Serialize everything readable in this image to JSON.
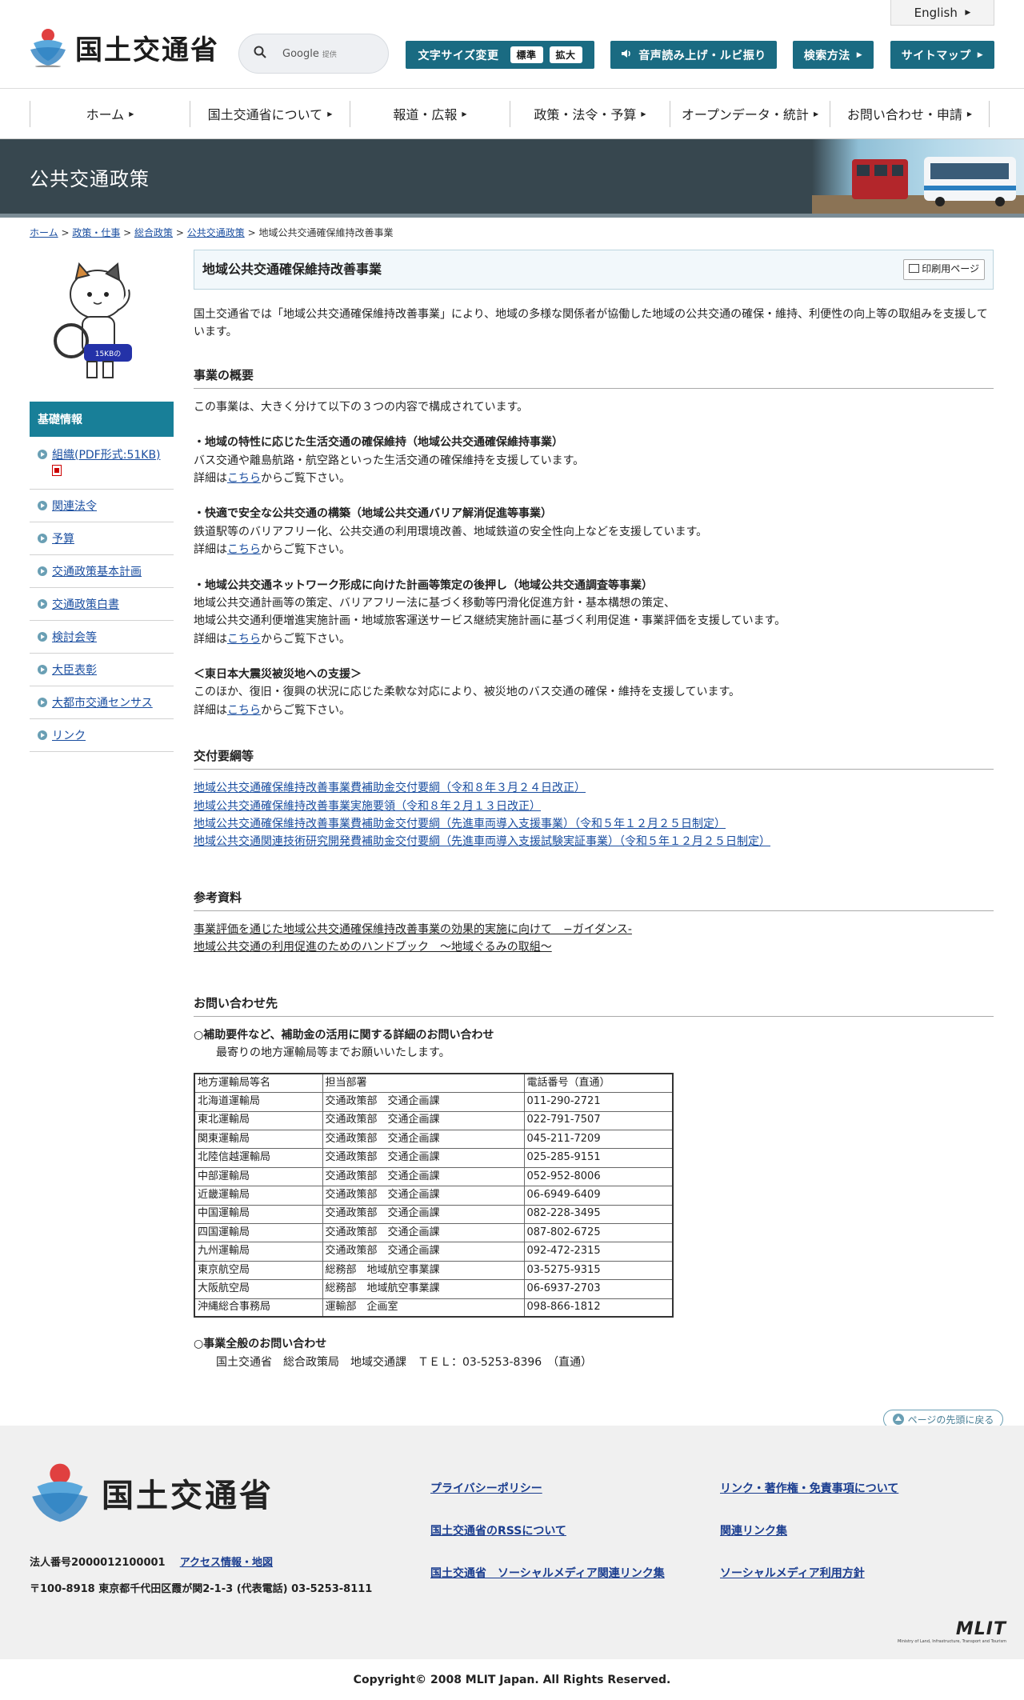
{
  "header": {
    "logo_text": "国土交通省",
    "search_label": "Google",
    "search_sub": "提供",
    "lang_label": "English",
    "font_size_label": "文字サイズ変更",
    "font_normal": "標準",
    "font_large": "拡大",
    "speech_label": "音声読み上げ・ルビ振り",
    "search_method": "検索方法",
    "sitemap": "サイトマップ"
  },
  "nav": [
    "ホーム",
    "国土交通省について",
    "報道・広報",
    "政策・法令・予算",
    "オープンデータ・統計",
    "お問い合わせ・申請"
  ],
  "banner": {
    "title": "公共交通政策"
  },
  "breadcrumb": [
    {
      "label": "ホーム",
      "link": true
    },
    {
      "label": "政策・仕事",
      "link": true
    },
    {
      "label": "総合政策",
      "link": true
    },
    {
      "label": "公共交通政策",
      "link": true
    },
    {
      "label": "地域公共交通確保維持改善事業",
      "link": false
    }
  ],
  "sidebar": {
    "mascot_text": "15KBの",
    "heading": "基礎情報",
    "items": [
      "組織(PDF形式:51KB)",
      "関連法令",
      "予算",
      "交通政策基本計画",
      "交通政策白書",
      "検討会等",
      "大臣表彰",
      "大都市交通センサス",
      "リンク"
    ]
  },
  "main": {
    "title": "地域公共交通確保維持改善事業",
    "print_label": "印刷用ページ",
    "intro": "国土交通省では「地域公共交通確保維持改善事業」により、地域の多様な関係者が協働した地域の公共交通の確保・維持、利便性の向上等の取組みを支援しています。",
    "overview_heading": "事業の概要",
    "overview_lead": "この事業は、大きく分けて以下の３つの内容で構成されています。",
    "detail_prefix": "詳細は",
    "detail_link": "こちら",
    "detail_suffix": "からご覧下さい。",
    "item1_title": "・地域の特性に応じた生活交通の確保維持（地域公共交通確保維持事業）",
    "item1_body": "バス交通や離島航路・航空路といった生活交通の確保維持を支援しています。",
    "item2_title": "・快適で安全な公共交通の構築（地域公共交通バリア解消促進等事業）",
    "item2_body": "鉄道駅等のバリアフリー化、公共交通の利用環境改善、地域鉄道の安全性向上などを支援しています。",
    "item3_title": "・地域公共交通ネットワーク形成に向けた計画等策定の後押し（地域公共交通調査等事業）",
    "item3_body1": "地域公共交通計画等の策定、バリアフリー法に基づく移動等円滑化促進方針・基本構想の策定、",
    "item3_body2": "地域公共交通利便増進実施計画・地域旅客運送サービス継続実施計画に基づく利用促進・事業評価を支援しています。",
    "item4_title": "＜東日本大震災被災地への支援＞",
    "item4_body": "このほか、復旧・復興の状況に応じた柔軟な対応により、被災地のバス交通の確保・維持を支援しています。",
    "youkou_heading": "交付要綱等",
    "youkou_links": [
      "地域公共交通確保維持改善事業費補助金交付要綱（令和８年３月２４日改正）",
      "地域公共交通確保維持改善事業実施要領（令和８年２月１３日改正）",
      "地域公共交通確保維持改善事業費補助金交付要綱（先進車両導入支援事業）（令和５年１２月２５日制定）",
      "地域公共交通関連技術研究開発費補助金交付要綱（先進車両導入支援試験実証事業）（令和５年１２月２５日制定）"
    ],
    "ref_heading": "参考資料",
    "ref_links": [
      "事業評価を通じた地域公共交通確保維持改善事業の効果的実施に向けて　−ガイダンス-",
      "地域公共交通の利用促進のためのハンドブック　～地域ぐるみの取組～"
    ],
    "contact_heading": "お問い合わせ先",
    "contact1_title": "○補助要件など、補助金の活用に関する詳細のお問い合わせ",
    "contact1_body": "最寄りの地方運輸局等までお願いいたします。",
    "table_header": [
      "地方運輸局等名",
      "担当部署",
      "電話番号（直通）"
    ],
    "table_rows": [
      [
        "北海道運輸局",
        "交通政策部　交通企画課",
        "011-290-2721"
      ],
      [
        "東北運輸局",
        "交通政策部　交通企画課",
        "022-791-7507"
      ],
      [
        "関東運輸局",
        "交通政策部　交通企画課",
        "045-211-7209"
      ],
      [
        "北陸信越運輸局",
        "交通政策部　交通企画課",
        "025-285-9151"
      ],
      [
        "中部運輸局",
        "交通政策部　交通企画課",
        "052-952-8006"
      ],
      [
        "近畿運輸局",
        "交通政策部　交通企画課",
        "06-6949-6409"
      ],
      [
        "中国運輸局",
        "交通政策部　交通企画課",
        "082-228-3495"
      ],
      [
        "四国運輸局",
        "交通政策部　交通企画課",
        "087-802-6725"
      ],
      [
        "九州運輸局",
        "交通政策部　交通企画課",
        "092-472-2315"
      ],
      [
        "東京航空局",
        "総務部　地域航空事業課",
        "03-5275-9315"
      ],
      [
        "大阪航空局",
        "総務部　地域航空事業課",
        "06-6937-2703"
      ],
      [
        "沖縄総合事務局",
        "運輸部　企画室",
        "098-866-1812"
      ]
    ],
    "contact2_title": "○事業全般のお問い合わせ",
    "contact2_body": "国土交通省　総合政策局　地域交通課　ＴＥＬ：03-5253-8396　（直通）"
  },
  "footer": {
    "to_top": "ページの先頭に戻る",
    "logo_text": "国土交通省",
    "corp_no": "法人番号2000012100001",
    "access": "アクセス情報・地図",
    "address": "〒100-8918 東京都千代田区霞が関2-1-3 (代表電話) 03-5253-8111",
    "links": [
      "プライバシーポリシー",
      "リンク・著作権・免責事項について",
      "国土交通省のRSSについて",
      "関連リンク集",
      "国土交通省　ソーシャルメディア関連リンク集",
      "ソーシャルメディア利用方針"
    ],
    "mlit": "MLIT",
    "mlit_sub": "Ministry of Land, Infrastructure, Transport and Tourism",
    "copyright": "Copyright© 2008 MLIT Japan. All Rights Reserved."
  },
  "colors": {
    "accent": "#1a6b82",
    "banner": "#37474f",
    "side_head": "#187f98",
    "link": "#1a4ea0"
  }
}
